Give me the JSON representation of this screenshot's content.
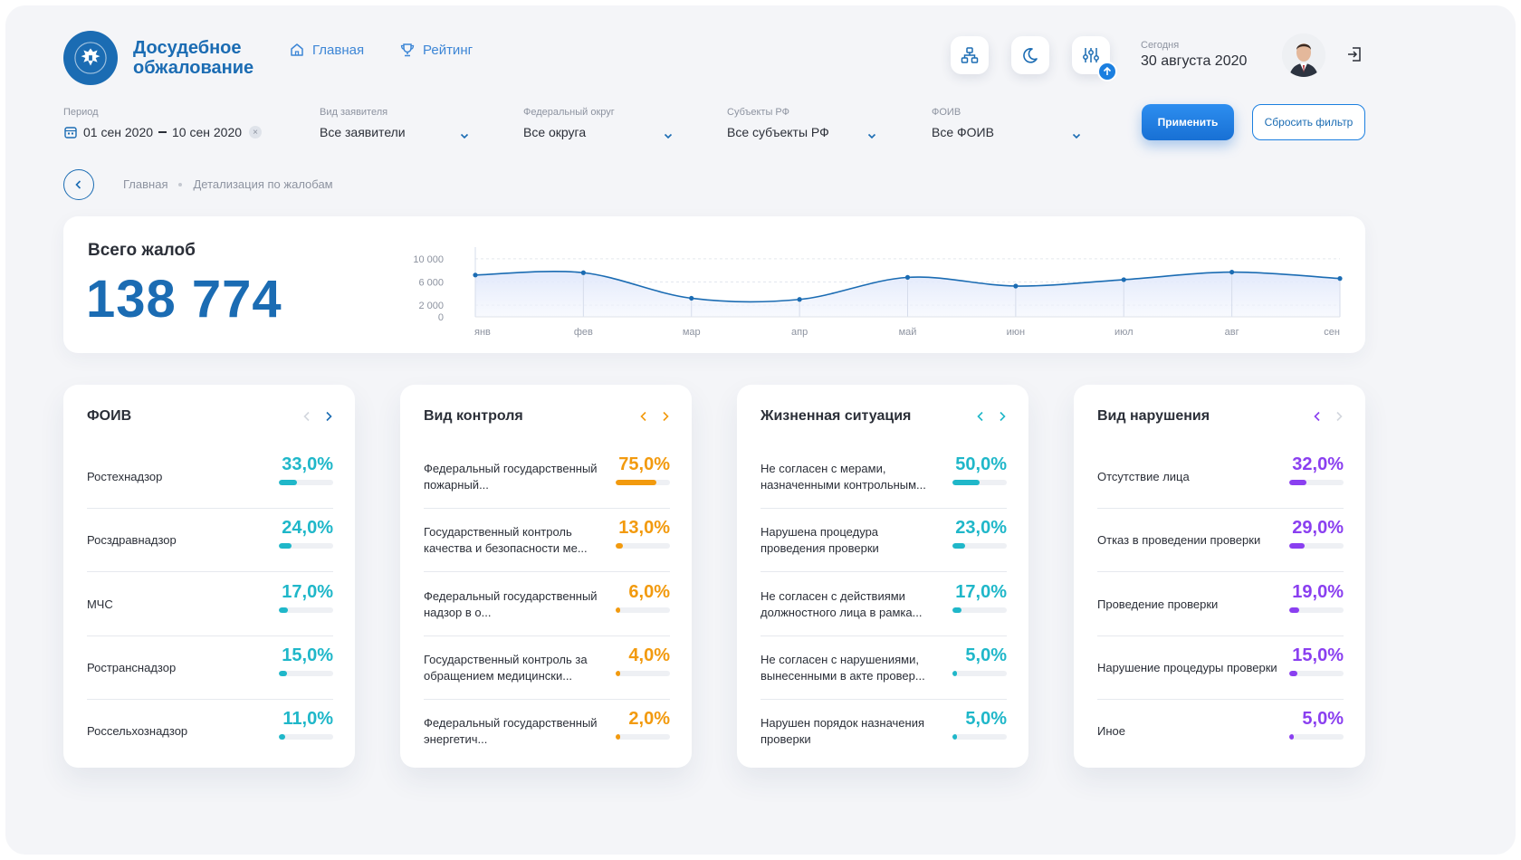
{
  "header": {
    "brand_line1": "Досудебное",
    "brand_line2": "обжалование",
    "nav_home": "Главная",
    "nav_rating": "Рейтинг",
    "today_label": "Сегодня",
    "today_date": "30 августа 2020"
  },
  "filters": {
    "period_label": "Период",
    "period_from": "01 сен 2020",
    "period_to": "10 сен 2020",
    "applicant_label": "Вид заявителя",
    "applicant_value": "Все заявители",
    "district_label": "Федеральный округ",
    "district_value": "Все округа",
    "subject_label": "Субъекты РФ",
    "subject_value": "Все субъекты РФ",
    "foiv_label": "ФОИВ",
    "foiv_value": "Все ФОИВ",
    "apply_label": "Применить",
    "reset_label": "Сбросить фильтр"
  },
  "breadcrumb": {
    "home": "Главная",
    "current": "Детализация по жалобам"
  },
  "total": {
    "title": "Всего жалоб",
    "value": "138 774"
  },
  "chart_data": {
    "type": "line",
    "categories": [
      "янв",
      "фев",
      "мар",
      "апр",
      "май",
      "июн",
      "июл",
      "авг",
      "сен"
    ],
    "values": [
      7200,
      7600,
      3200,
      3000,
      6800,
      5300,
      6400,
      7700,
      6600
    ],
    "yticks": [
      "10 000",
      "6 000",
      "2 000",
      "0"
    ],
    "ylim": [
      0,
      12000
    ],
    "grid": true
  },
  "colors": {
    "brand": "#1b6cb3",
    "teal": "#1fb7c9",
    "orange": "#f29a0e",
    "violet": "#8a3ff0",
    "line": "#1b6cb3"
  },
  "cards": [
    {
      "title": "ФОИВ",
      "color": "#1fb7c9",
      "prev_enabled": false,
      "next_enabled": true,
      "rows": [
        {
          "name": "Ростехнадзор",
          "pct": "33,0%",
          "frac": 0.33
        },
        {
          "name": "Росздравнадзор",
          "pct": "24,0%",
          "frac": 0.24
        },
        {
          "name": "МЧС",
          "pct": "17,0%",
          "frac": 0.17
        },
        {
          "name": "Ространснадзор",
          "pct": "15,0%",
          "frac": 0.15
        },
        {
          "name": "Россельхознадзор",
          "pct": "11,0%",
          "frac": 0.11
        }
      ]
    },
    {
      "title": "Вид контроля",
      "color": "#f29a0e",
      "prev_enabled": true,
      "next_enabled": true,
      "rows": [
        {
          "name": "Федеральный государственный пожарный...",
          "pct": "75,0%",
          "frac": 0.75
        },
        {
          "name": "Государственный контроль качества и безопасности ме...",
          "pct": "13,0%",
          "frac": 0.13
        },
        {
          "name": "Федеральный государственный надзор в о...",
          "pct": "6,0%",
          "frac": 0.06
        },
        {
          "name": "Государственный контроль за обращением медицински...",
          "pct": "4,0%",
          "frac": 0.04
        },
        {
          "name": "Федеральный государственный энергетич...",
          "pct": "2,0%",
          "frac": 0.02
        }
      ]
    },
    {
      "title": "Жизненная ситуация",
      "color": "#1fb7c9",
      "prev_enabled": true,
      "next_enabled": true,
      "rows": [
        {
          "name": "Не согласен с мерами, назначенными контрольным...",
          "pct": "50,0%",
          "frac": 0.5
        },
        {
          "name": "Нарушена процедура проведения проверки",
          "pct": "23,0%",
          "frac": 0.23
        },
        {
          "name": "Не согласен с действиями должностного лица в рамка...",
          "pct": "17,0%",
          "frac": 0.17
        },
        {
          "name": "Не согласен с нарушениями, вынесенными в акте провер...",
          "pct": "5,0%",
          "frac": 0.05
        },
        {
          "name": "Нарушен порядок назначения проверки",
          "pct": "5,0%",
          "frac": 0.05
        }
      ]
    },
    {
      "title": "Вид нарушения",
      "color": "#8a3ff0",
      "prev_enabled": true,
      "next_enabled": false,
      "rows": [
        {
          "name": "Отсутствие лица",
          "pct": "32,0%",
          "frac": 0.32
        },
        {
          "name": "Отказ в проведении проверки",
          "pct": "29,0%",
          "frac": 0.29
        },
        {
          "name": "Проведение проверки",
          "pct": "19,0%",
          "frac": 0.19
        },
        {
          "name": "Нарушение процедуры проверки",
          "pct": "15,0%",
          "frac": 0.15
        },
        {
          "name": "Иное",
          "pct": "5,0%",
          "frac": 0.05
        }
      ]
    }
  ]
}
